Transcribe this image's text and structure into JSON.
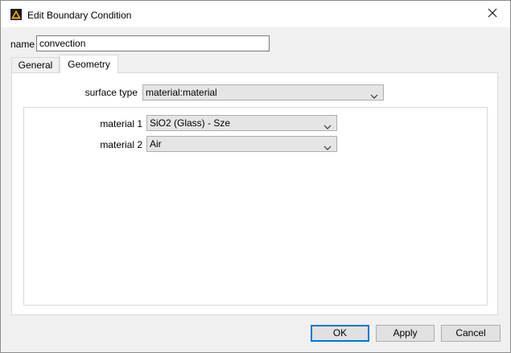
{
  "window": {
    "title": "Edit Boundary Condition",
    "app_icon": "warning-triangle-icon",
    "close_icon": "close-icon"
  },
  "name_field": {
    "label": "name",
    "value": "convection"
  },
  "tabs": [
    {
      "label": "General",
      "active": false
    },
    {
      "label": "Geometry",
      "active": true
    }
  ],
  "geometry": {
    "surface_type": {
      "label": "surface type",
      "value": "material:material"
    },
    "material1": {
      "label": "material 1",
      "value": "SiO2 (Glass) - Sze"
    },
    "material2": {
      "label": "material 2",
      "value": "Air"
    }
  },
  "buttons": {
    "ok": "OK",
    "apply": "Apply",
    "cancel": "Cancel"
  },
  "colors": {
    "accent": "#0078d7",
    "icon_fill": "#f5a623",
    "window_bg": "#f0f0f0"
  }
}
